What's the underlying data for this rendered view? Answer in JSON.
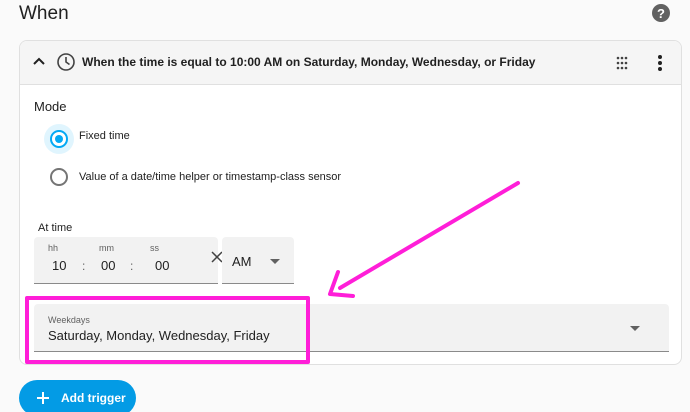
{
  "section": {
    "title": "When",
    "help_icon": "help-circle-icon",
    "help_glyph": "?"
  },
  "trigger": {
    "description": "When the time is equal to 10:00 AM on Saturday, Monday, Wednesday, or Friday",
    "icons": [
      "chevron-up-icon",
      "clock-icon",
      "drag-handle-icon",
      "more-vert-icon"
    ],
    "mode": {
      "label": "Mode",
      "options": [
        {
          "label": "Fixed time",
          "selected": true
        },
        {
          "label": "Value of a date/time helper or timestamp-class sensor",
          "selected": false
        }
      ]
    },
    "at_time": {
      "label": "At time",
      "hours_label": "hh",
      "hours_value": "10",
      "minutes_label": "mm",
      "minutes_value": "00",
      "seconds_label": "ss",
      "seconds_value": "00",
      "separator": ":",
      "period": "AM"
    },
    "weekdays": {
      "label": "Weekdays",
      "value": "Saturday, Monday, Wednesday, Friday"
    }
  },
  "add_trigger": {
    "label": "Add trigger"
  },
  "colors": {
    "accent": "#03a9f4",
    "button": "#039be5",
    "annotation": "#ff1ed8"
  }
}
